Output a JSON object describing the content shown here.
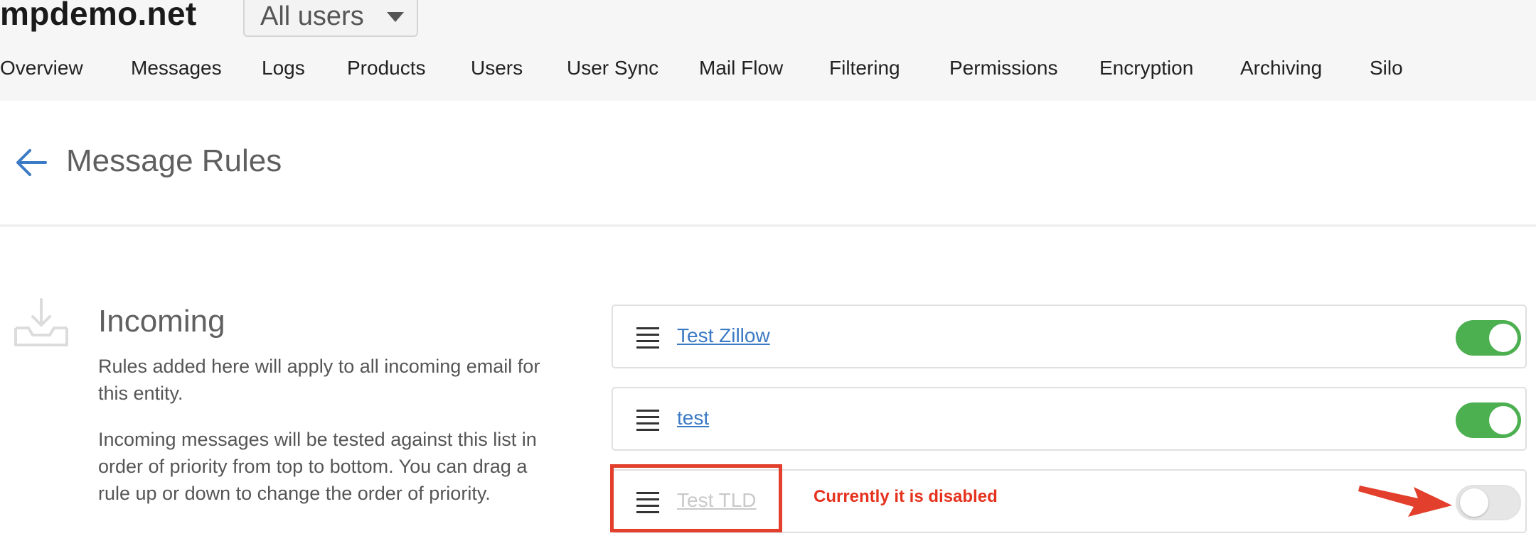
{
  "header": {
    "site_name": "mpdemo.net",
    "scope_selector": {
      "selected": "All users"
    }
  },
  "nav": {
    "items": [
      {
        "label": "Overview"
      },
      {
        "label": "Messages"
      },
      {
        "label": "Logs"
      },
      {
        "label": "Products"
      },
      {
        "label": "Users"
      },
      {
        "label": "User Sync"
      },
      {
        "label": "Mail Flow"
      },
      {
        "label": "Filtering"
      },
      {
        "label": "Permissions"
      },
      {
        "label": "Encryption"
      },
      {
        "label": "Archiving"
      },
      {
        "label": "Silo"
      }
    ]
  },
  "page": {
    "title": "Message Rules"
  },
  "incoming": {
    "heading": "Incoming",
    "description_1": "Rules added here will apply to all incoming email for this entity.",
    "description_2": "Incoming messages will be tested against this list in order of priority from top to bottom. You can drag a rule up or down to change the order of priority."
  },
  "rules": [
    {
      "name": "Test Zillow",
      "enabled": true
    },
    {
      "name": "test",
      "enabled": true
    },
    {
      "name": "Test TLD",
      "enabled": false
    }
  ],
  "annotation": {
    "text": "Currently it is disabled"
  },
  "colors": {
    "accent_blue": "#3b7ac4",
    "toggle_on": "#4caf50",
    "toggle_off": "#e6e6e6",
    "annotation_red": "#e2402c"
  },
  "icons": {
    "back": "back-arrow-icon",
    "inbox": "inbox-download-icon",
    "drag": "drag-handle-icon",
    "dropdown": "chevron-down-icon"
  }
}
